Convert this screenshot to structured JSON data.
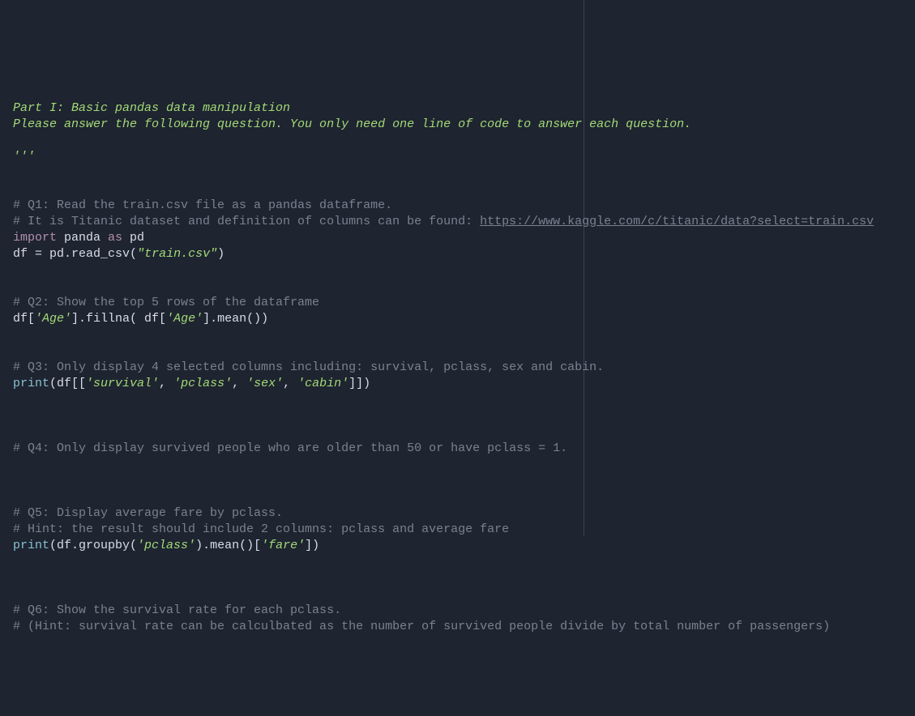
{
  "code": {
    "docstring_line1": "Part I: Basic pandas data manipulation",
    "docstring_line2": "Please answer the following question. You only need one line of code to answer each question.",
    "docstring_close": "'''",
    "q1_comment1": "# Q1: Read the train.csv file as a pandas dataframe.",
    "q1_comment2_prefix": "# It is Titanic dataset and definition of columns can be found: ",
    "q1_url": "https://www.kaggle.com/c/titanic/data?select=train.csv",
    "q1_import_kw": "import",
    "q1_import_mod": " panda ",
    "q1_as_kw": "as",
    "q1_alias": " pd",
    "q1_code_l1": "df ",
    "q1_code_eq": "=",
    "q1_code_l2": " pd.read_csv(",
    "q1_string": "\"train.csv\"",
    "q1_code_l3": ")",
    "q2_comment": "# Q2: Show the top 5 rows of the dataframe",
    "q2_code_p1": "df[",
    "q2_str1": "'Age'",
    "q2_code_p2": "].fillna( df[",
    "q2_str2": "'Age'",
    "q2_code_p3": "].mean())",
    "q3_comment": "# Q3: Only display 4 selected columns including: survival, pclass, sex and cabin.",
    "q3_print": "print",
    "q3_code_p1": "(df[[",
    "q3_str1": "'survival'",
    "q3_comma1": ", ",
    "q3_str2": "'pclass'",
    "q3_comma2": ", ",
    "q3_str3": "'sex'",
    "q3_comma3": ", ",
    "q3_str4": "'cabin'",
    "q3_code_p2": "]])",
    "q4_comment": "# Q4: Only display survived people who are older than 50 or have pclass = 1.",
    "q5_comment1": "# Q5: Display average fare by pclass.",
    "q5_comment2": "# Hint: the result should include 2 columns: pclass and average fare",
    "q5_print": "print",
    "q5_code_p1": "(df.groupby(",
    "q5_str1": "'pclass'",
    "q5_code_p2": ").mean()[",
    "q5_str2": "'fare'",
    "q5_code_p3": "])",
    "q6_comment1": "# Q6: Show the survival rate for each pclass.",
    "q6_comment2": "# (Hint: survival rate can be calculbated as the number of survived people divide by total number of passengers)"
  }
}
